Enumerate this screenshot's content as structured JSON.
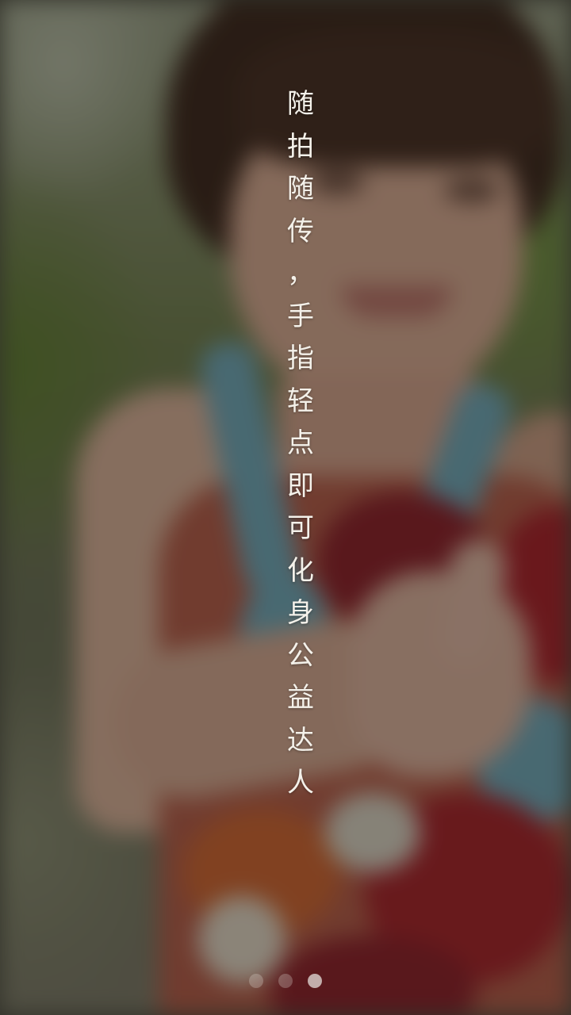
{
  "tagline": {
    "text": "随拍随传，手指轻点即可化身公益达人",
    "characters": [
      "随",
      "拍",
      "随",
      "传",
      "，",
      "手",
      "指",
      "轻",
      "点",
      "即",
      "可",
      "化",
      "身",
      "公",
      "益",
      "达",
      "人"
    ]
  },
  "pager": {
    "total": 3,
    "active_index": 2
  }
}
